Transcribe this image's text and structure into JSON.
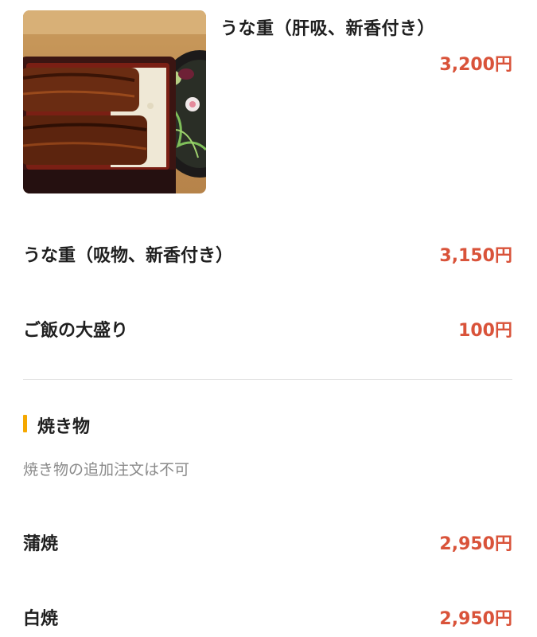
{
  "featured_item": {
    "name": "うな重（肝吸、新香付き）",
    "price": "3,200円",
    "image": "unaju-photo"
  },
  "menu_items": [
    {
      "name": "うな重（吸物、新香付き）",
      "price": "3,150円"
    },
    {
      "name": "ご飯の大盛り",
      "price": "100円"
    }
  ],
  "section": {
    "title": "焼き物",
    "note": "焼き物の追加注文は不可",
    "items": [
      {
        "name": "蒲焼",
        "price": "2,950円"
      },
      {
        "name": "白焼",
        "price": "2,950円"
      }
    ]
  },
  "colors": {
    "price": "#d9533a",
    "section_accent": "#f5a800",
    "divider": "#e2e2e2"
  }
}
